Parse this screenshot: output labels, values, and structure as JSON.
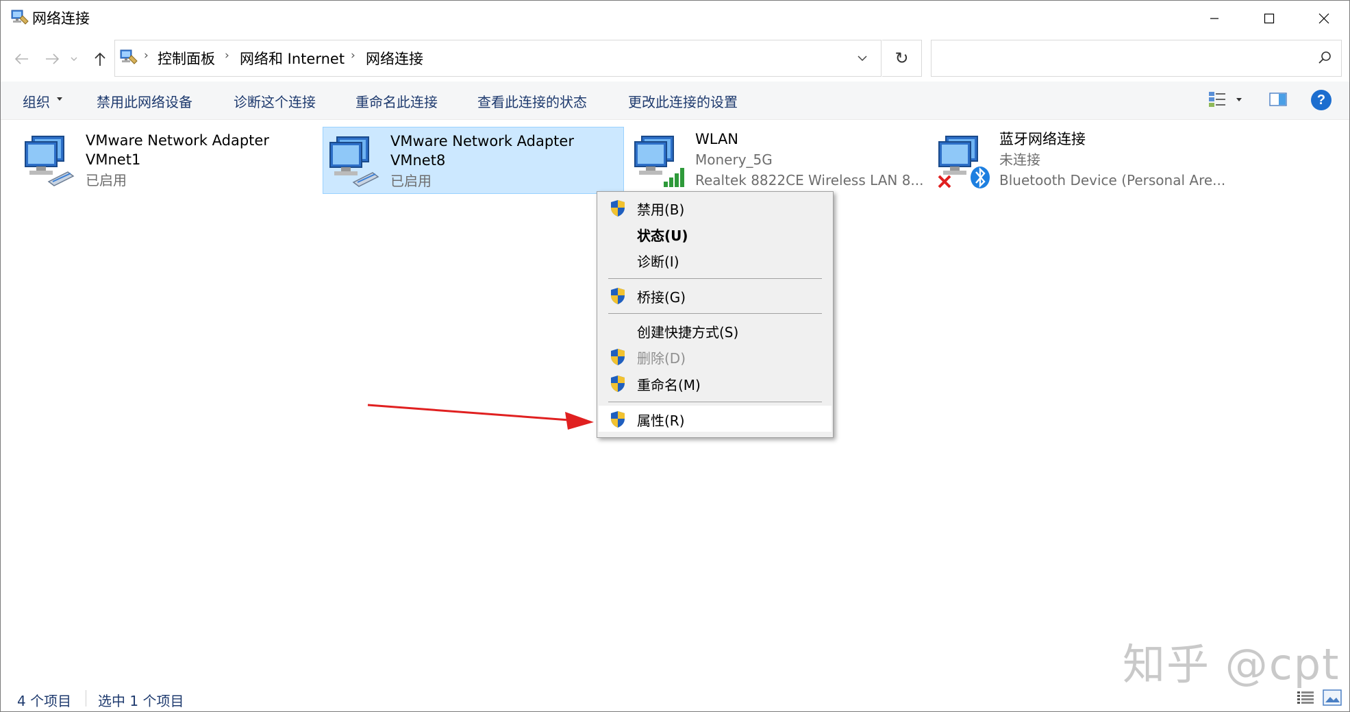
{
  "window": {
    "title": "网络连接",
    "controls": {
      "minimize": "minimize-icon",
      "maximize": "maximize-icon",
      "close": "close-icon"
    }
  },
  "nav": {
    "back": "back-arrow-icon",
    "forward": "forward-arrow-icon",
    "recent": "chevron-down-icon",
    "up": "up-arrow-icon"
  },
  "address": {
    "breadcrumbs": [
      "控制面板",
      "网络和 Internet",
      "网络连接"
    ],
    "separator": "›",
    "refresh": "↻"
  },
  "search": {
    "placeholder": ""
  },
  "command_bar": {
    "organize": "组织",
    "items": [
      "禁用此网络设备",
      "诊断这个连接",
      "重命名此连接",
      "查看此连接的状态",
      "更改此连接的设置"
    ]
  },
  "adapters": [
    {
      "name": "VMware Network Adapter",
      "name2": "VMnet1",
      "status": "已启用",
      "selected": false
    },
    {
      "name": "VMware Network Adapter",
      "name2": "VMnet8",
      "status": "已启用",
      "selected": true
    },
    {
      "name": "WLAN",
      "line2": "Monery_5G",
      "line3": "Realtek 8822CE Wireless LAN 8...",
      "selected": false
    },
    {
      "name": "蓝牙网络连接",
      "line2": "未连接",
      "line3": "Bluetooth Device (Personal Are...",
      "selected": false
    }
  ],
  "context_menu": {
    "items": [
      {
        "label": "禁用(B)",
        "shield": true
      },
      {
        "label": "状态(U)",
        "shield": false,
        "bold": true
      },
      {
        "label": "诊断(I)",
        "shield": false
      },
      {
        "label": "桥接(G)",
        "shield": true
      },
      {
        "label": "创建快捷方式(S)",
        "shield": false
      },
      {
        "label": "删除(D)",
        "shield": true,
        "disabled": true
      },
      {
        "label": "重命名(M)",
        "shield": true
      },
      {
        "label": "属性(R)",
        "shield": true,
        "highlighted": true
      }
    ]
  },
  "help": "?",
  "status_bar": {
    "count": "4 个项目",
    "selected": "选中 1 个项目"
  },
  "watermark": "知乎 @cpt",
  "colors": {
    "accent": "#1d6ecf",
    "selection": "#cce8ff",
    "selection_border": "#99d1ff",
    "arrow": "#e02020",
    "link_text": "#1e3a6e"
  }
}
